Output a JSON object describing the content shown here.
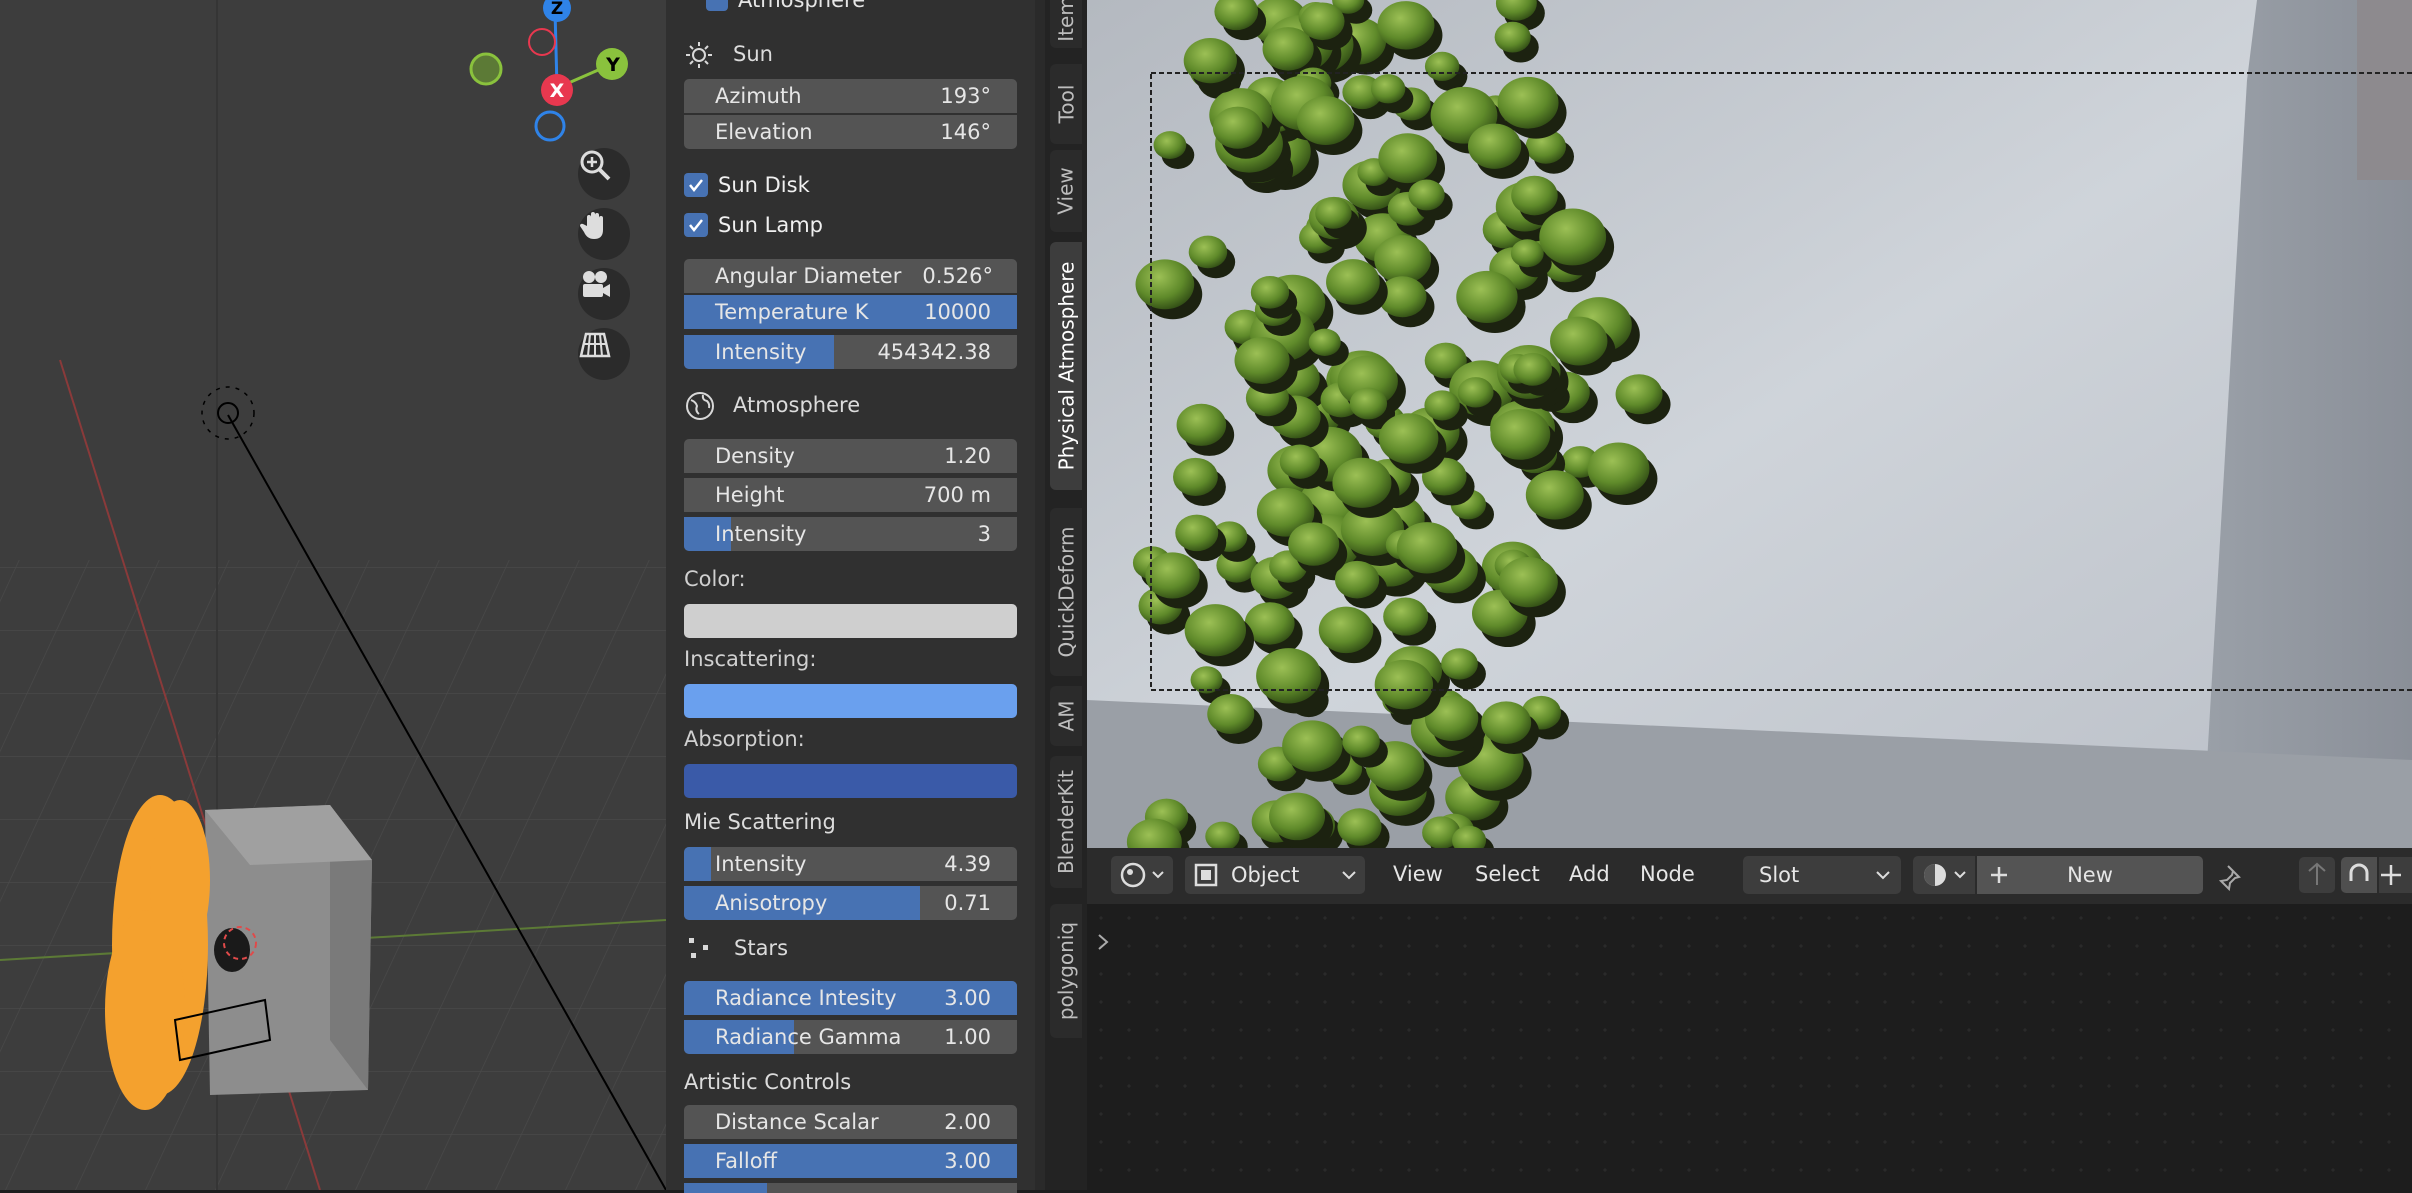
{
  "sidebar": {
    "panel_header": "Atmosphere",
    "sun": {
      "title": "Sun",
      "azimuth": {
        "label": "Azimuth",
        "value": "193°"
      },
      "elevation": {
        "label": "Elevation",
        "value": "146°"
      },
      "sun_disk": {
        "label": "Sun Disk",
        "checked": true
      },
      "sun_lamp": {
        "label": "Sun Lamp",
        "checked": true
      },
      "angular_diameter": {
        "label": "Angular Diameter",
        "value": "0.526°"
      },
      "temperature": {
        "label": "Temperature K",
        "value": "10000",
        "fill": 1.0
      },
      "intensity": {
        "label": "Intensity",
        "value": "454342.38",
        "fill": 0.45
      }
    },
    "atmosphere": {
      "title": "Atmosphere",
      "density": {
        "label": "Density",
        "value": "1.20"
      },
      "height": {
        "label": "Height",
        "value": "700 m"
      },
      "intensity": {
        "label": "Intensity",
        "value": "3",
        "fill": 0.14
      },
      "color_label": "Color:",
      "color": "#cfcfcf",
      "inscattering_label": "Inscattering:",
      "inscattering_color": "#6aa0ee",
      "absorption_label": "Absorption:",
      "absorption_color": "#3a5aa8"
    },
    "mie": {
      "title": "Mie Scattering",
      "intensity": {
        "label": "Intensity",
        "value": "4.39",
        "fill": 0.08
      },
      "anisotropy": {
        "label": "Anisotropy",
        "value": "0.71",
        "fill": 0.71
      }
    },
    "stars": {
      "title": "Stars",
      "radiance_intensity": {
        "label": "Radiance Intesity",
        "value": "3.00",
        "fill": 1.0
      },
      "radiance_gamma": {
        "label": "Radiance Gamma",
        "value": "1.00",
        "fill": 0.33
      }
    },
    "artistic": {
      "title": "Artistic Controls",
      "distance_scalar": {
        "label": "Distance Scalar",
        "value": "2.00"
      },
      "falloff": {
        "label": "Falloff",
        "value": "3.00",
        "fill": 1.0
      }
    }
  },
  "tabs": [
    "Item",
    "Tool",
    "View",
    "Physical Atmosphere",
    "QuickDeform",
    "AM",
    "BlenderKit",
    "polygoniq"
  ],
  "active_tab": "Physical Atmosphere",
  "gizmo": {
    "z": "Z",
    "y": "Y",
    "x": "X"
  },
  "node_editor": {
    "mode": "Object",
    "menus": [
      "View",
      "Select",
      "Add",
      "Node"
    ],
    "slot": "Slot",
    "new_button": "New"
  },
  "colors": {
    "accent": "#4772b3",
    "field": "#545454",
    "panel": "#303030",
    "axis_x": "#e8384f",
    "axis_y": "#8ac23d",
    "axis_z": "#2f83e8"
  }
}
